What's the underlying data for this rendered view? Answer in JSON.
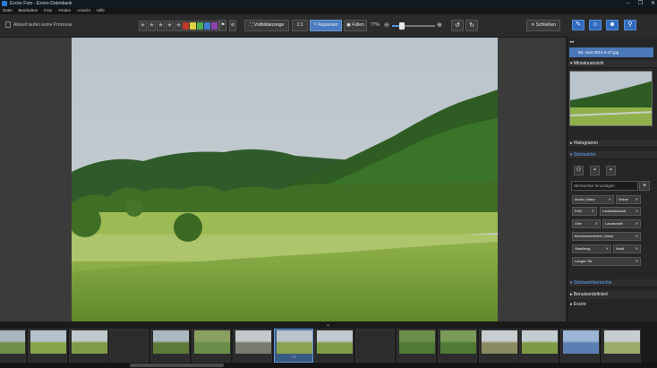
{
  "window": {
    "title": "Excire Foto - Excire-Datenbank",
    "controls": [
      "–",
      "❐",
      "✕"
    ]
  },
  "menu": [
    "Datei",
    "Bearbeiten",
    "Foto",
    "Finden",
    "Ansicht",
    "Hilfe"
  ],
  "toolbar": {
    "status": "Aktuell laufen keine Prozesse",
    "stars": [
      "★",
      "★",
      "★",
      "★",
      "★"
    ],
    "colors": [
      "#c0392b",
      "#e0d040",
      "#4caf50",
      "#3f7fd0",
      "#8e44ad"
    ],
    "fullscreen": "Vollbildanzeige",
    "one_to_one": "1:1",
    "fit": "Anpassen",
    "fill": "Füllen",
    "zoom_pct": "77%",
    "zoom_level": 0.22,
    "close": "Schließen"
  },
  "panel": {
    "file_name": "08.-Juni-2014-4-47.jpg",
    "thumbnail_title": "Miniaturansicht",
    "histogram_title": "Histogramm",
    "keywords_title": "Stichwörter",
    "keyword_placeholder": "Stichwörter hinzufügen",
    "tags": [
      [
        "Inhalt | Natur",
        "Wiese"
      ],
      [
        "Feld",
        "Landwirtschaft"
      ],
      [
        "Orte",
        "Landschaft"
      ],
      [
        "Benutzerdefiniert | Natur"
      ],
      [
        "Streitberg",
        "Wald"
      ],
      [
        "Langes Tal"
      ]
    ],
    "hierarchy_title": "Stichworthierarchie",
    "hierarchy_items": [
      "Benutzerdefiniert",
      "Excire"
    ]
  },
  "filmstrip": {
    "count": 16,
    "selected_index": 7,
    "selected_label": "P3"
  }
}
